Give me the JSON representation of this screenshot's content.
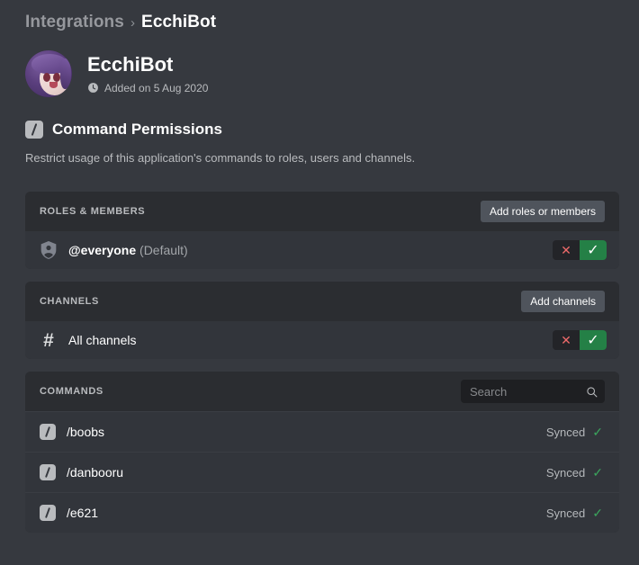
{
  "breadcrumb": {
    "parent": "Integrations",
    "separator": "›",
    "current": "EcchiBot"
  },
  "app": {
    "name": "EcchiBot",
    "added_text": "Added on 5 Aug 2020",
    "clock_icon": "clock-icon",
    "avatar_icon": "bot-avatar"
  },
  "section": {
    "icon": "slash-command-icon",
    "title": "Command Permissions",
    "description": "Restrict usage of this application's commands to roles, users and channels."
  },
  "roles_panel": {
    "label": "ROLES & MEMBERS",
    "button": "Add roles or members",
    "rows": [
      {
        "icon": "shield-person-icon",
        "name": "@everyone",
        "suffix": "(Default)",
        "deny_icon": "✕",
        "allow_icon": "✓",
        "state": "allow"
      }
    ]
  },
  "channels_panel": {
    "label": "CHANNELS",
    "button": "Add channels",
    "rows": [
      {
        "icon": "hash-icon",
        "name": "All channels",
        "deny_icon": "✕",
        "allow_icon": "✓",
        "state": "allow"
      }
    ]
  },
  "commands_panel": {
    "label": "COMMANDS",
    "search": {
      "placeholder": "Search",
      "value": "",
      "icon": "search-icon"
    },
    "rows": [
      {
        "icon": "slash-command-icon",
        "name": "/boobs",
        "status": "Synced",
        "status_icon": "✓"
      },
      {
        "icon": "slash-command-icon",
        "name": "/danbooru",
        "status": "Synced",
        "status_icon": "✓"
      },
      {
        "icon": "slash-command-icon",
        "name": "/e621",
        "status": "Synced",
        "status_icon": "✓"
      }
    ]
  },
  "colors": {
    "background": "#36393f",
    "panel": "#2b2d31",
    "row": "#32353b",
    "button": "#4f545c",
    "allow_green": "#248046",
    "deny_red": "#ed6a6a",
    "synced_green": "#3ba55d",
    "search_field": "#1e1f22"
  }
}
